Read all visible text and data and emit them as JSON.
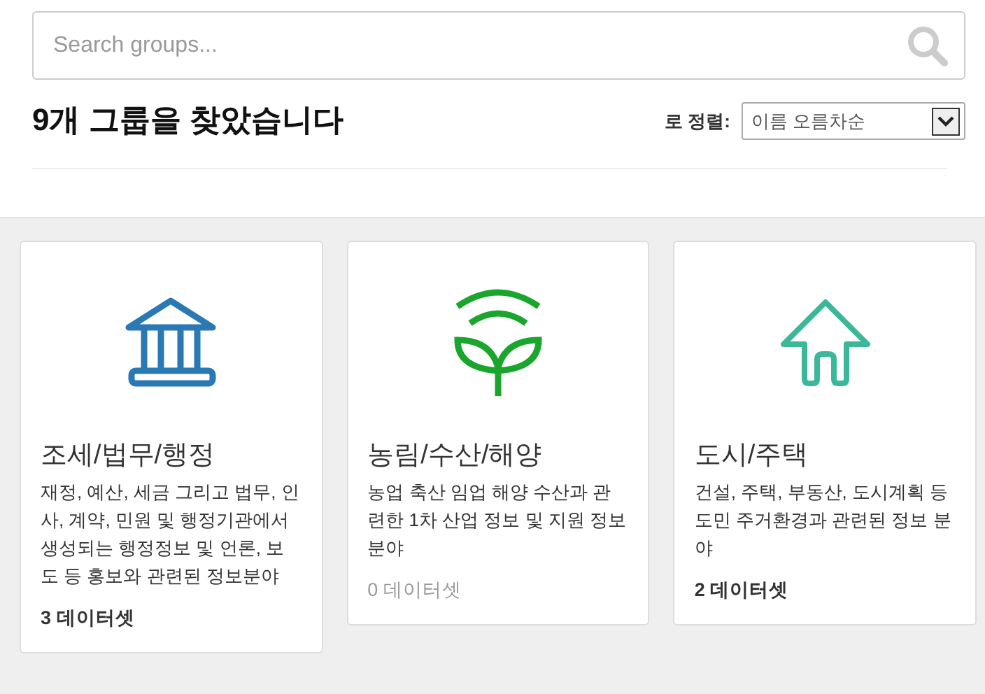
{
  "search": {
    "placeholder": "Search groups..."
  },
  "result_heading": "9개 그룹을 찾았습니다",
  "sort": {
    "label": "로 정렬:",
    "value": "이름 오름차순"
  },
  "groups": [
    {
      "kind": "bank",
      "color": "#2a78b4",
      "title": "조세/법무/행정",
      "description": "재정, 예산, 세금 그리고 법무, 인사, 계약, 민원 및 행정기관에서 생성되는 행정정보 및 언론, 보도 등 홍보와 관련된 정보분야",
      "count": "3 데이터셋",
      "empty": false
    },
    {
      "kind": "plant",
      "color": "#1aa52c",
      "title": "농림/수산/해양",
      "description": "농업 축산 임업 해양 수산과 관련한 1차 산업 정보 및 지원 정보 분야",
      "count": "0 데이터셋",
      "empty": true
    },
    {
      "kind": "house",
      "color": "#3bb89a",
      "title": "도시/주택",
      "description": "건설, 주택, 부동산, 도시계획 등 도민 주거환경과 관련된 정보 분야",
      "count": "2 데이터셋",
      "empty": false
    }
  ]
}
